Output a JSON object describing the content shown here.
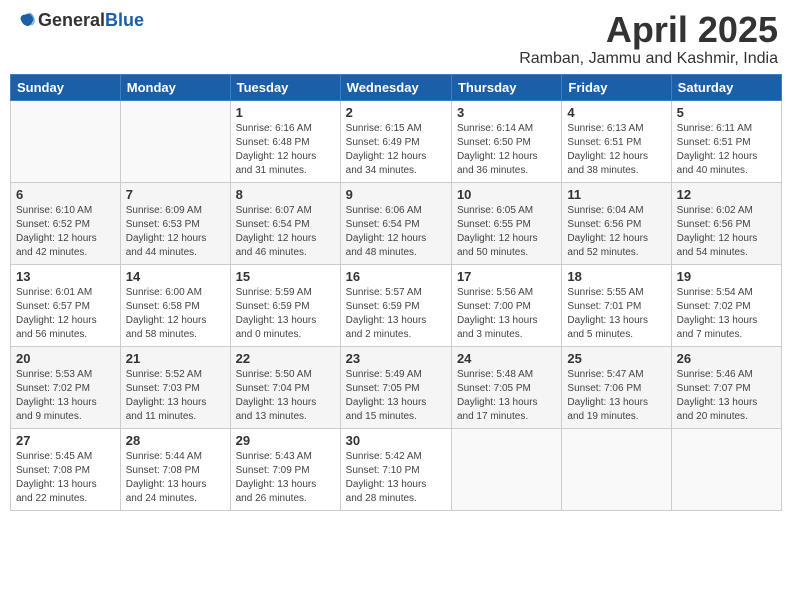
{
  "header": {
    "logo_general": "General",
    "logo_blue": "Blue",
    "month": "April 2025",
    "location": "Ramban, Jammu and Kashmir, India"
  },
  "weekdays": [
    "Sunday",
    "Monday",
    "Tuesday",
    "Wednesday",
    "Thursday",
    "Friday",
    "Saturday"
  ],
  "weeks": [
    [
      {
        "day": "",
        "detail": ""
      },
      {
        "day": "",
        "detail": ""
      },
      {
        "day": "1",
        "detail": "Sunrise: 6:16 AM\nSunset: 6:48 PM\nDaylight: 12 hours\nand 31 minutes."
      },
      {
        "day": "2",
        "detail": "Sunrise: 6:15 AM\nSunset: 6:49 PM\nDaylight: 12 hours\nand 34 minutes."
      },
      {
        "day": "3",
        "detail": "Sunrise: 6:14 AM\nSunset: 6:50 PM\nDaylight: 12 hours\nand 36 minutes."
      },
      {
        "day": "4",
        "detail": "Sunrise: 6:13 AM\nSunset: 6:51 PM\nDaylight: 12 hours\nand 38 minutes."
      },
      {
        "day": "5",
        "detail": "Sunrise: 6:11 AM\nSunset: 6:51 PM\nDaylight: 12 hours\nand 40 minutes."
      }
    ],
    [
      {
        "day": "6",
        "detail": "Sunrise: 6:10 AM\nSunset: 6:52 PM\nDaylight: 12 hours\nand 42 minutes."
      },
      {
        "day": "7",
        "detail": "Sunrise: 6:09 AM\nSunset: 6:53 PM\nDaylight: 12 hours\nand 44 minutes."
      },
      {
        "day": "8",
        "detail": "Sunrise: 6:07 AM\nSunset: 6:54 PM\nDaylight: 12 hours\nand 46 minutes."
      },
      {
        "day": "9",
        "detail": "Sunrise: 6:06 AM\nSunset: 6:54 PM\nDaylight: 12 hours\nand 48 minutes."
      },
      {
        "day": "10",
        "detail": "Sunrise: 6:05 AM\nSunset: 6:55 PM\nDaylight: 12 hours\nand 50 minutes."
      },
      {
        "day": "11",
        "detail": "Sunrise: 6:04 AM\nSunset: 6:56 PM\nDaylight: 12 hours\nand 52 minutes."
      },
      {
        "day": "12",
        "detail": "Sunrise: 6:02 AM\nSunset: 6:56 PM\nDaylight: 12 hours\nand 54 minutes."
      }
    ],
    [
      {
        "day": "13",
        "detail": "Sunrise: 6:01 AM\nSunset: 6:57 PM\nDaylight: 12 hours\nand 56 minutes."
      },
      {
        "day": "14",
        "detail": "Sunrise: 6:00 AM\nSunset: 6:58 PM\nDaylight: 12 hours\nand 58 minutes."
      },
      {
        "day": "15",
        "detail": "Sunrise: 5:59 AM\nSunset: 6:59 PM\nDaylight: 13 hours\nand 0 minutes."
      },
      {
        "day": "16",
        "detail": "Sunrise: 5:57 AM\nSunset: 6:59 PM\nDaylight: 13 hours\nand 2 minutes."
      },
      {
        "day": "17",
        "detail": "Sunrise: 5:56 AM\nSunset: 7:00 PM\nDaylight: 13 hours\nand 3 minutes."
      },
      {
        "day": "18",
        "detail": "Sunrise: 5:55 AM\nSunset: 7:01 PM\nDaylight: 13 hours\nand 5 minutes."
      },
      {
        "day": "19",
        "detail": "Sunrise: 5:54 AM\nSunset: 7:02 PM\nDaylight: 13 hours\nand 7 minutes."
      }
    ],
    [
      {
        "day": "20",
        "detail": "Sunrise: 5:53 AM\nSunset: 7:02 PM\nDaylight: 13 hours\nand 9 minutes."
      },
      {
        "day": "21",
        "detail": "Sunrise: 5:52 AM\nSunset: 7:03 PM\nDaylight: 13 hours\nand 11 minutes."
      },
      {
        "day": "22",
        "detail": "Sunrise: 5:50 AM\nSunset: 7:04 PM\nDaylight: 13 hours\nand 13 minutes."
      },
      {
        "day": "23",
        "detail": "Sunrise: 5:49 AM\nSunset: 7:05 PM\nDaylight: 13 hours\nand 15 minutes."
      },
      {
        "day": "24",
        "detail": "Sunrise: 5:48 AM\nSunset: 7:05 PM\nDaylight: 13 hours\nand 17 minutes."
      },
      {
        "day": "25",
        "detail": "Sunrise: 5:47 AM\nSunset: 7:06 PM\nDaylight: 13 hours\nand 19 minutes."
      },
      {
        "day": "26",
        "detail": "Sunrise: 5:46 AM\nSunset: 7:07 PM\nDaylight: 13 hours\nand 20 minutes."
      }
    ],
    [
      {
        "day": "27",
        "detail": "Sunrise: 5:45 AM\nSunset: 7:08 PM\nDaylight: 13 hours\nand 22 minutes."
      },
      {
        "day": "28",
        "detail": "Sunrise: 5:44 AM\nSunset: 7:08 PM\nDaylight: 13 hours\nand 24 minutes."
      },
      {
        "day": "29",
        "detail": "Sunrise: 5:43 AM\nSunset: 7:09 PM\nDaylight: 13 hours\nand 26 minutes."
      },
      {
        "day": "30",
        "detail": "Sunrise: 5:42 AM\nSunset: 7:10 PM\nDaylight: 13 hours\nand 28 minutes."
      },
      {
        "day": "",
        "detail": ""
      },
      {
        "day": "",
        "detail": ""
      },
      {
        "day": "",
        "detail": ""
      }
    ]
  ]
}
